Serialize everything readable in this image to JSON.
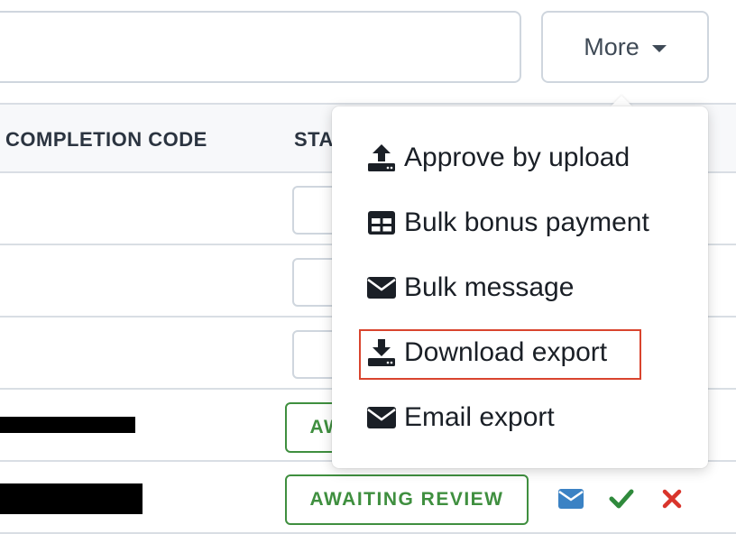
{
  "search": {
    "value": "",
    "placeholder": ""
  },
  "more_button": {
    "label": "More"
  },
  "table": {
    "headers": {
      "completion_code": "COMPLETION CODE",
      "status": "STATUS"
    },
    "rows": [
      {
        "status_badge": ""
      },
      {
        "status_badge": ""
      },
      {
        "status_badge": ""
      },
      {
        "status_badge": "AWAITING REVIEW"
      },
      {
        "status_badge": "AWAITING REVIEW"
      }
    ]
  },
  "menu": {
    "items": [
      {
        "label": "Approve by upload",
        "icon": "upload-icon"
      },
      {
        "label": "Bulk bonus payment",
        "icon": "table-icon"
      },
      {
        "label": "Bulk message",
        "icon": "envelope-icon"
      },
      {
        "label": "Download export",
        "icon": "download-icon",
        "highlighted": true
      },
      {
        "label": "Email export",
        "icon": "envelope-icon"
      }
    ]
  },
  "colors": {
    "badge_green": "#3f8f3f",
    "message_blue": "#3b82c4",
    "approve_green": "#2f8a3c",
    "reject_red": "#d9342b",
    "highlight_red": "#d9442e"
  }
}
